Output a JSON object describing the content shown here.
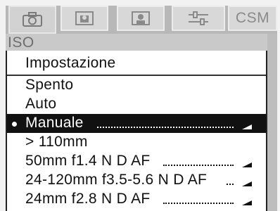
{
  "tabs": [
    {
      "icon": "camera-icon",
      "active": true
    },
    {
      "icon": "shooting-menu-icon",
      "active": false
    },
    {
      "icon": "custom-setting-icon",
      "active": false
    },
    {
      "icon": "setup-sliders-icon",
      "active": false
    },
    {
      "label": "CSM",
      "active": false
    }
  ],
  "page": {
    "label": "ISO"
  },
  "menu": {
    "header": "Impostazione",
    "items": [
      {
        "label": "Spento",
        "selected": false,
        "has_submenu": false
      },
      {
        "label": "Auto",
        "selected": false,
        "has_submenu": false
      },
      {
        "label": "Manuale",
        "selected": true,
        "has_submenu": true
      },
      {
        "label": "> 110mm",
        "selected": false,
        "has_submenu": false
      },
      {
        "label": "50mm f1.4 N D AF",
        "selected": false,
        "has_submenu": true
      },
      {
        "label": "24-120mm f3.5-5.6 N D AF",
        "selected": false,
        "has_submenu": true
      },
      {
        "label": "24mm f2.8 N D AF",
        "selected": false,
        "has_submenu": true
      }
    ]
  },
  "colors": {
    "selected_bg": "#111111",
    "selected_fg": "#ffffff",
    "tab_bar": "#b8b8b8"
  }
}
